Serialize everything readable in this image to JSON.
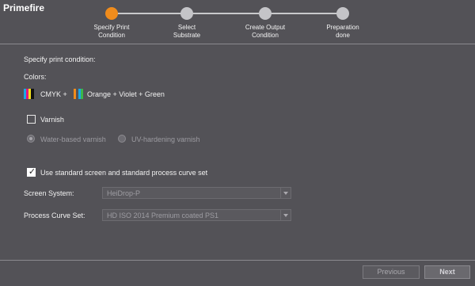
{
  "app": {
    "title": "Primefire"
  },
  "stepper": {
    "steps": [
      {
        "label": "Specify Print\nCondition",
        "active": true
      },
      {
        "label": "Select\nSubstrate",
        "active": false
      },
      {
        "label": "Create Output\nCondition",
        "active": false
      },
      {
        "label": "Preparation\ndone",
        "active": false
      }
    ],
    "active_color": "#f08c1c"
  },
  "form": {
    "heading": "Specify print condition:",
    "colors_label": "Colors:",
    "cmyk_label": "CMYK +",
    "extended_label": "Orange + Violet + Green",
    "varnish": {
      "label": "Varnish",
      "checked": false
    },
    "varnish_options": [
      {
        "label": "Water-based varnish",
        "selected": true
      },
      {
        "label": "UV-hardening varnish",
        "selected": false
      }
    ],
    "standard_curves": {
      "label": "Use standard screen and standard process curve set",
      "checked": true
    },
    "screen_system": {
      "label": "Screen System:",
      "value": "HeiDrop-P"
    },
    "process_curve": {
      "label": "Process Curve Set:",
      "value": "HD ISO 2014 Premium coated PS1"
    }
  },
  "footer": {
    "previous_label": "Previous",
    "next_label": "Next"
  },
  "swatch_colors": {
    "cmyk": [
      "#1aa7e6",
      "#e8157e",
      "#f5e21a",
      "#111111"
    ],
    "extended": [
      "#f08c1c",
      "#1aa7e6",
      "#3bb54a"
    ]
  }
}
